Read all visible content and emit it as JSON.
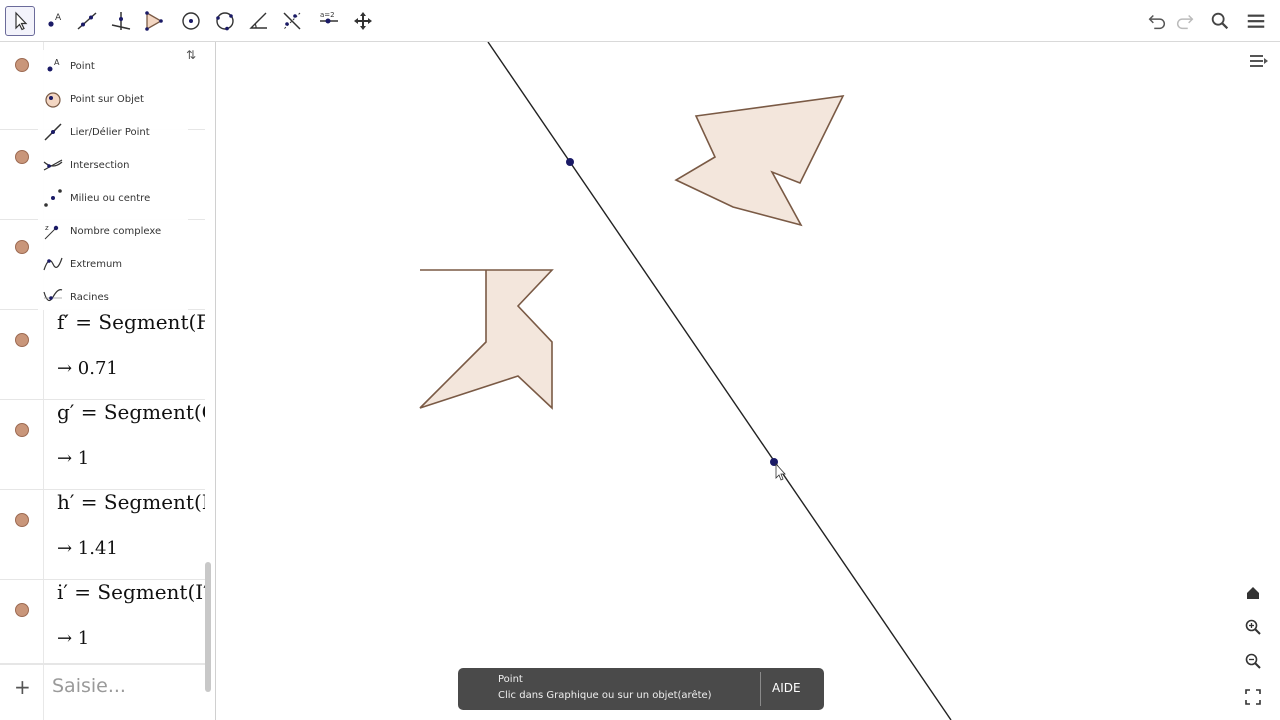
{
  "toolbar": {
    "tools": [
      {
        "name": "move-tool-button",
        "icon": "arrow-cursor-icon",
        "active": true
      },
      {
        "name": "point-tool-button",
        "icon": "point-icon"
      },
      {
        "name": "line-tool-button",
        "icon": "line-icon"
      },
      {
        "name": "perpendicular-tool-button",
        "icon": "perpendicular-icon"
      },
      {
        "name": "polygon-tool-button",
        "icon": "polygon-icon"
      },
      {
        "name": "circle-tool-button",
        "icon": "circle-center-icon"
      },
      {
        "name": "circle-three-points-tool-button",
        "icon": "circle-icon"
      },
      {
        "name": "angle-tool-button",
        "icon": "angle-icon"
      },
      {
        "name": "reflect-tool-button",
        "icon": "reflect-line-icon"
      },
      {
        "name": "slider-tool-button",
        "icon": "slider-icon"
      },
      {
        "name": "move-graphics-tool-button",
        "icon": "move-view-icon"
      }
    ],
    "right": [
      "undo-icon",
      "redo-icon",
      "search-icon",
      "menu-icon"
    ]
  },
  "algebra": {
    "rows": [
      {
        "def": "f′ = Segment(F",
        "value": "→ 0.71"
      },
      {
        "def": "g′ = Segment(G",
        "value": "→ 1"
      },
      {
        "def": "h′ = Segment(H",
        "value": "→ 1.41"
      },
      {
        "def": "i′ = Segment(I′",
        "value": "→ 1"
      }
    ],
    "input_placeholder": "Saisie...",
    "plus": "+"
  },
  "menu": {
    "items": [
      {
        "label": "Point",
        "icon": "point-icon"
      },
      {
        "label": "Point sur Objet",
        "icon": "point-on-object-icon"
      },
      {
        "label": "Lier/Délier Point",
        "icon": "attach-point-icon"
      },
      {
        "label": "Intersection",
        "icon": "intersection-icon"
      },
      {
        "label": "Milieu ou centre",
        "icon": "midpoint-icon"
      },
      {
        "label": "Nombre complexe",
        "icon": "complex-number-icon"
      },
      {
        "label": "Extremum",
        "icon": "extremum-icon"
      },
      {
        "label": "Racines",
        "icon": "roots-icon"
      }
    ]
  },
  "graphics": {
    "nav": [
      "home-icon",
      "zoom-in-icon",
      "zoom-out-icon",
      "fullscreen-icon"
    ]
  },
  "tooltip": {
    "title": "Point",
    "text": "Clic dans Graphique ou sur un objet(arête)",
    "help": "AIDE"
  },
  "colors": {
    "shape_fill": "#f3e6dc",
    "shape_stroke": "#7a5a45",
    "line": "#222222",
    "point": "#1a1a66",
    "dot": "#c9967a"
  }
}
